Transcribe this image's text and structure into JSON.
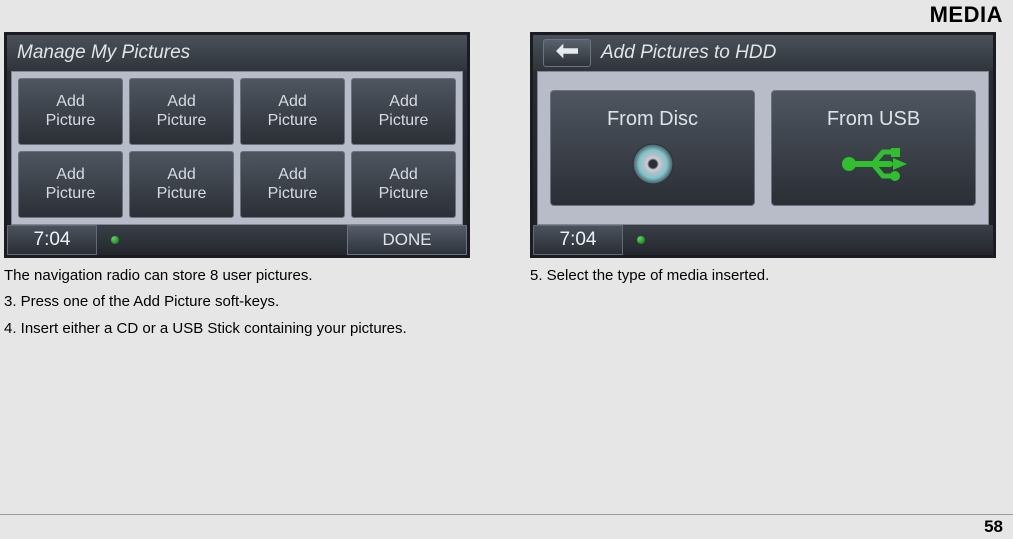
{
  "header": {
    "section_title": "MEDIA"
  },
  "screen1": {
    "title": "Manage My Pictures",
    "buttons": [
      {
        "line1": "Add",
        "line2": "Picture"
      },
      {
        "line1": "Add",
        "line2": "Picture"
      },
      {
        "line1": "Add",
        "line2": "Picture"
      },
      {
        "line1": "Add",
        "line2": "Picture"
      },
      {
        "line1": "Add",
        "line2": "Picture"
      },
      {
        "line1": "Add",
        "line2": "Picture"
      },
      {
        "line1": "Add",
        "line2": "Picture"
      },
      {
        "line1": "Add",
        "line2": "Picture"
      }
    ],
    "clock": "7:04",
    "done": "DONE",
    "captions": [
      "The navigation radio can store 8 user pictures.",
      "3. Press one of the Add Picture soft-keys.",
      "4. Insert either a CD or a USB Stick containing your pictures."
    ]
  },
  "screen2": {
    "title": "Add Pictures to HDD",
    "options": {
      "disc": "From Disc",
      "usb": "From USB"
    },
    "clock": "7:04",
    "captions": [
      "5. Select the type of media inserted."
    ]
  },
  "page_number": "58"
}
